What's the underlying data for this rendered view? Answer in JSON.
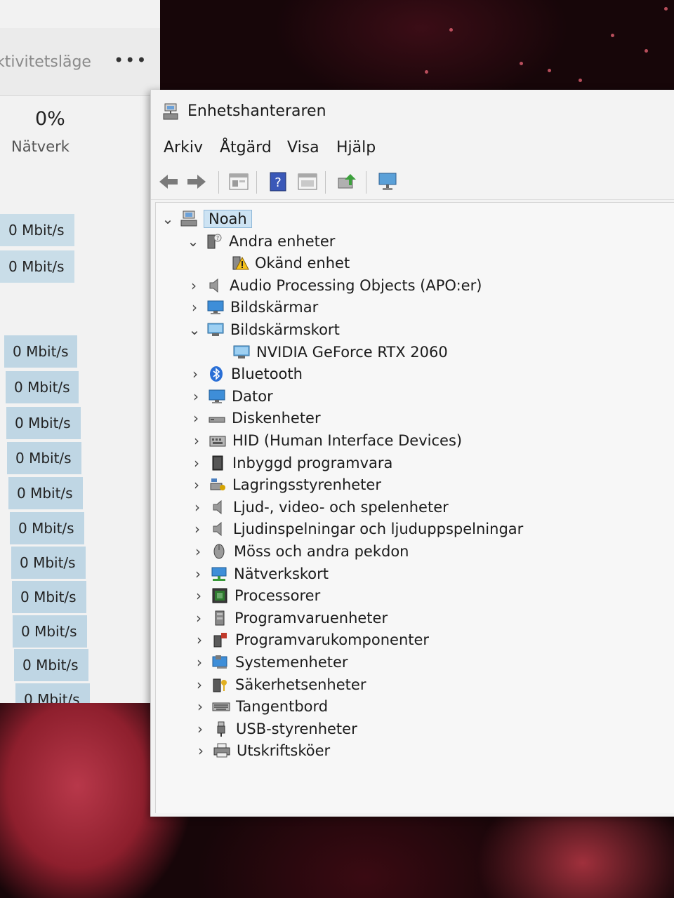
{
  "task_manager": {
    "mode_label": "ktivitetsläge",
    "more_label": "•••",
    "network_percent": "0%",
    "network_label": "Nätverk",
    "rows": [
      "0 Mbit/s",
      "0 Mbit/s",
      "0 Mbit/s",
      "0 Mbit/s",
      "0 Mbit/s",
      "0 Mbit/s",
      "0 Mbit/s",
      "0 Mbit/s",
      "0 Mbit/s",
      "0 Mbit/s",
      "0 Mbit/s",
      "0 Mbit/s",
      "0 Mbit/s"
    ]
  },
  "device_manager": {
    "title": "Enhetshanteraren",
    "menu": [
      "Arkiv",
      "Åtgärd",
      "Visa",
      "Hjälp"
    ],
    "toolbar": [
      "back-icon",
      "forward-icon",
      "properties-icon",
      "help-icon",
      "view-icon",
      "update-driver-icon",
      "monitor-scan-icon"
    ],
    "tree": [
      {
        "label": "Noah",
        "level": 0,
        "state": "expanded",
        "icon": "computer-icon"
      },
      {
        "label": "Andra enheter",
        "level": 1,
        "state": "expanded",
        "icon": "unknown-device-icon"
      },
      {
        "label": "Okänd enhet",
        "level": 2,
        "state": "leaf",
        "icon": "warning-device-icon"
      },
      {
        "label": "Audio Processing Objects (APO:er)",
        "level": 1,
        "state": "collapsed",
        "icon": "speaker-icon"
      },
      {
        "label": "Bildskärmar",
        "level": 1,
        "state": "collapsed",
        "icon": "monitor-icon"
      },
      {
        "label": "Bildskärmskort",
        "level": 1,
        "state": "expanded",
        "icon": "display-adapter-icon"
      },
      {
        "label": "NVIDIA GeForce RTX 2060",
        "level": 2,
        "state": "leaf",
        "icon": "display-adapter-icon"
      },
      {
        "label": "Bluetooth",
        "level": 1,
        "state": "collapsed",
        "icon": "bluetooth-icon"
      },
      {
        "label": "Dator",
        "level": 1,
        "state": "collapsed",
        "icon": "monitor-icon"
      },
      {
        "label": "Diskenheter",
        "level": 1,
        "state": "collapsed",
        "icon": "disk-icon"
      },
      {
        "label": "HID (Human Interface Devices)",
        "level": 1,
        "state": "collapsed",
        "icon": "hid-icon"
      },
      {
        "label": "Inbyggd programvara",
        "level": 1,
        "state": "collapsed",
        "icon": "firmware-icon"
      },
      {
        "label": "Lagringsstyrenheter",
        "level": 1,
        "state": "collapsed",
        "icon": "storage-controller-icon"
      },
      {
        "label": "Ljud-, video- och spelenheter",
        "level": 1,
        "state": "collapsed",
        "icon": "speaker-icon"
      },
      {
        "label": "Ljudinspelningar och ljuduppspelningar",
        "level": 1,
        "state": "collapsed",
        "icon": "speaker-icon"
      },
      {
        "label": "Möss och andra pekdon",
        "level": 1,
        "state": "collapsed",
        "icon": "mouse-icon"
      },
      {
        "label": "Nätverkskort",
        "level": 1,
        "state": "collapsed",
        "icon": "network-icon"
      },
      {
        "label": "Processorer",
        "level": 1,
        "state": "collapsed",
        "icon": "processor-icon"
      },
      {
        "label": "Programvaruenheter",
        "level": 1,
        "state": "collapsed",
        "icon": "software-device-icon"
      },
      {
        "label": "Programvarukomponenter",
        "level": 1,
        "state": "collapsed",
        "icon": "software-component-icon"
      },
      {
        "label": "Systemenheter",
        "level": 1,
        "state": "collapsed",
        "icon": "system-device-icon"
      },
      {
        "label": "Säkerhetsenheter",
        "level": 1,
        "state": "collapsed",
        "icon": "security-device-icon"
      },
      {
        "label": "Tangentbord",
        "level": 1,
        "state": "collapsed",
        "icon": "keyboard-icon"
      },
      {
        "label": "USB-styrenheter",
        "level": 1,
        "state": "collapsed",
        "icon": "usb-icon"
      },
      {
        "label": "Utskriftsköer",
        "level": 1,
        "state": "collapsed",
        "icon": "printer-icon"
      }
    ]
  }
}
